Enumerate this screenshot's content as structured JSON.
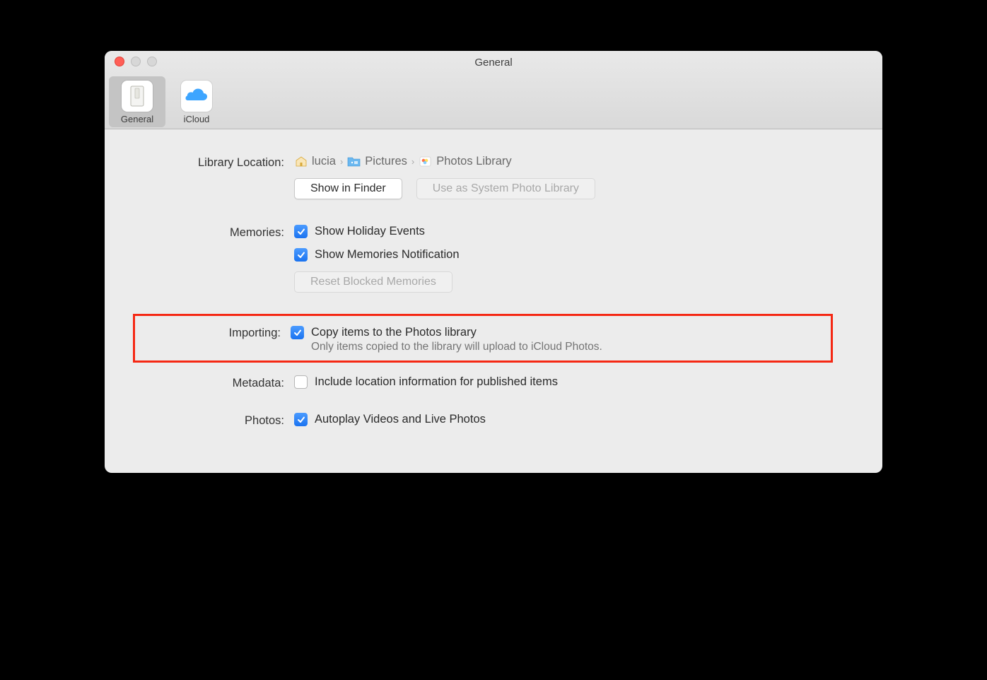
{
  "window": {
    "title": "General"
  },
  "tabs": {
    "general": "General",
    "icloud": "iCloud"
  },
  "library": {
    "label": "Library Location:",
    "crumb1": "lucia",
    "crumb2": "Pictures",
    "crumb3": "Photos Library",
    "show_in_finder": "Show in Finder",
    "use_as_system": "Use as System Photo Library"
  },
  "memories": {
    "label": "Memories:",
    "holiday": "Show Holiday Events",
    "notification": "Show Memories Notification",
    "reset": "Reset Blocked Memories"
  },
  "importing": {
    "label": "Importing:",
    "copy": "Copy items to the Photos library",
    "note": "Only items copied to the library will upload to iCloud Photos."
  },
  "metadata": {
    "label": "Metadata:",
    "include": "Include location information for published items"
  },
  "photos": {
    "label": "Photos:",
    "autoplay": "Autoplay Videos and Live Photos"
  }
}
